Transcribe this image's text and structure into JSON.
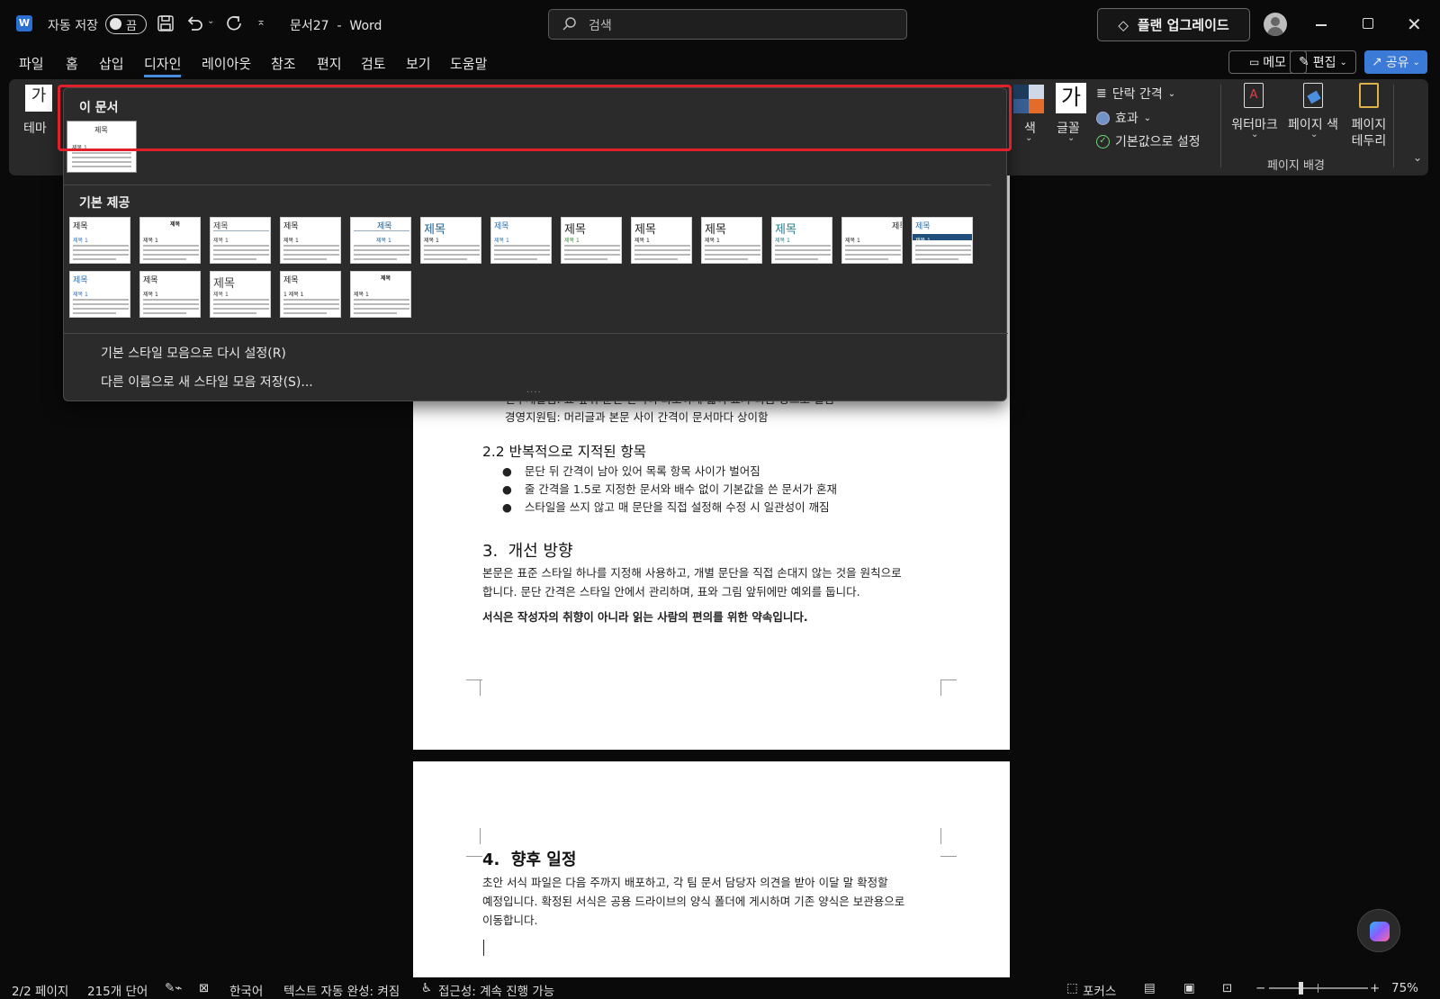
{
  "titlebar": {
    "autosave_label": "자동 저장",
    "autosave_state": "끔",
    "doc_title": "문서27  -  Word",
    "search_placeholder": "검색",
    "upgrade_label": "플랜 업그레이드"
  },
  "tabs": [
    "파일",
    "홈",
    "삽입",
    "디자인",
    "레이아웃",
    "참조",
    "편지",
    "검토",
    "보기",
    "도움말"
  ],
  "active_tab": "디자인",
  "right_buttons": {
    "memo": "메모",
    "edit": "편집",
    "share": "공유"
  },
  "ribbon": {
    "theme_label": "테마",
    "theme_glyph": "가",
    "colors_label": "색",
    "fonts_label": "글꼴",
    "fonts_glyph": "가",
    "paragraph_spacing": "단락 간격",
    "effects": "효과",
    "set_default": "기본값으로 설정",
    "watermark": "워터마크",
    "page_color": "페이지 색",
    "page_borders_1": "페이지",
    "page_borders_2": "테두리",
    "group_page_background": "페이지 배경"
  },
  "dropdown": {
    "this_document": "이 문서",
    "builtin": "기본 제공",
    "reset_label": "기본 스타일 모음으로 다시 설정(R)",
    "save_as_label": "다른 이름으로 새 스타일 모음 저장(S)...",
    "thumb_title": "제목",
    "thumb_heading": "제목 1",
    "thumb_heading_alt": "1  제목 1"
  },
  "document": {
    "partial_line": "연구개발팀: 표 앞뒤 문단 간격이 과도하게 넓어 표가 다음 장으로 밀림",
    "line_hr": "경영지원팀: 머리글과 본문 사이 간격이 문서마다 상이함",
    "sec_2_2": "2.2 반복적으로 지적된 항목",
    "bullets": [
      "문단 뒤 간격이 남아 있어 목록 항목 사이가 벌어짐",
      "줄 간격을 1.5로 지정한 문서와 배수 없이 기본값을 쓴 문서가 혼재",
      "스타일을 쓰지 않고 매 문단을 직접 설정해 수정 시 일관성이 깨짐"
    ],
    "sec_3": "3.  개선 방향",
    "para_3_line1": "본문은 표준 스타일 하나를 지정해 사용하고, 개별 문단을 직접 손대지 않는 것을 원칙으로",
    "para_3_line2": "합니다. 문단 간격은 스타일 안에서 관리하며, 표와 그림 앞뒤에만 예외를 둡니다.",
    "bold_line": "서식은 작성자의 취향이 아니라 읽는 사람의 편의를 위한 약속입니다.",
    "sec_4": "4.  향후 일정",
    "para_4_line1": "초안 서식 파일은 다음 주까지 배포하고, 각 팀 문서 담당자 의견을 받아 이달 말 확정할",
    "para_4_line2": "예정입니다. 확정된 서식은 공용 드라이브의 양식 폴더에 게시하며 기존 양식은 보관용으로",
    "para_4_line3": "이동합니다."
  },
  "status": {
    "page": "2/2 페이지",
    "words": "215개 단어",
    "language": "한국어",
    "autocomplete": "텍스트 자동 완성: 켜짐",
    "accessibility": "접근성: 계속 진행 가능",
    "focus": "포커스",
    "zoom": "75%"
  },
  "colors": {
    "accent": "#4a8fe0",
    "highlight": "#e0202a",
    "share_bg": "#3b7ad6"
  }
}
